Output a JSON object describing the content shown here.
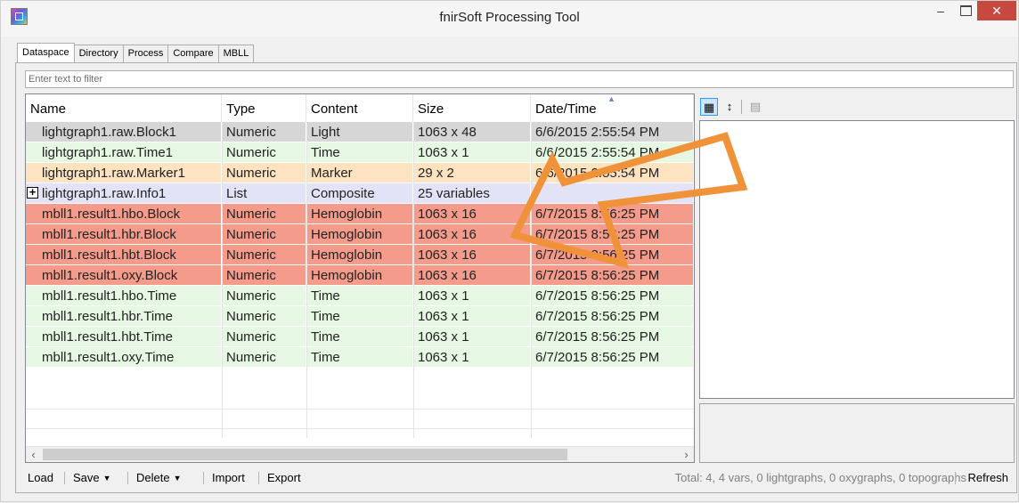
{
  "window": {
    "title": "fnirSoft Processing Tool",
    "minimize": "–",
    "close": "✕"
  },
  "tabs": [
    "Dataspace",
    "Directory",
    "Process",
    "Compare",
    "MBLL"
  ],
  "active_tab": "Dataspace",
  "filter": {
    "placeholder": "Enter text to filter"
  },
  "table": {
    "columns": [
      "Name",
      "Type",
      "Content",
      "Size",
      "Date/Time"
    ],
    "sorted_column": "Date/Time",
    "rows": [
      {
        "name": "lightgraph1.raw.Block1",
        "type": "Numeric",
        "content": "Light",
        "size": "1063 x 48",
        "datetime": "6/6/2015 2:55:54 PM",
        "color": "#d6d6d6",
        "expandable": false
      },
      {
        "name": "lightgraph1.raw.Time1",
        "type": "Numeric",
        "content": "Time",
        "size": "1063 x 1",
        "datetime": "6/6/2015 2:55:54 PM",
        "color": "#e6f7e3",
        "expandable": false
      },
      {
        "name": "lightgraph1.raw.Marker1",
        "type": "Numeric",
        "content": "Marker",
        "size": "29 x 2",
        "datetime": "6/6/2015 2:55:54 PM",
        "color": "#fde3c0",
        "expandable": false
      },
      {
        "name": "lightgraph1.raw.Info1",
        "type": "List",
        "content": "Composite",
        "size": "25 variables",
        "datetime": "",
        "color": "#e3e3f7",
        "expandable": true
      },
      {
        "name": "mbll1.result1.hbo.Block",
        "type": "Numeric",
        "content": "Hemoglobin",
        "size": "1063 x 16",
        "datetime": "6/7/2015 8:56:25 PM",
        "color": "#f59b8b",
        "expandable": false
      },
      {
        "name": "mbll1.result1.hbr.Block",
        "type": "Numeric",
        "content": "Hemoglobin",
        "size": "1063 x 16",
        "datetime": "6/7/2015 8:56:25 PM",
        "color": "#f59b8b",
        "expandable": false
      },
      {
        "name": "mbll1.result1.hbt.Block",
        "type": "Numeric",
        "content": "Hemoglobin",
        "size": "1063 x 16",
        "datetime": "6/7/2015 8:56:25 PM",
        "color": "#f59b8b",
        "expandable": false
      },
      {
        "name": "mbll1.result1.oxy.Block",
        "type": "Numeric",
        "content": "Hemoglobin",
        "size": "1063 x 16",
        "datetime": "6/7/2015 8:56:25 PM",
        "color": "#f59b8b",
        "expandable": false
      },
      {
        "name": "mbll1.result1.hbo.Time",
        "type": "Numeric",
        "content": "Time",
        "size": "1063 x 1",
        "datetime": "6/7/2015 8:56:25 PM",
        "color": "#e6f7e3",
        "expandable": false
      },
      {
        "name": "mbll1.result1.hbr.Time",
        "type": "Numeric",
        "content": "Time",
        "size": "1063 x 1",
        "datetime": "6/7/2015 8:56:25 PM",
        "color": "#e6f7e3",
        "expandable": false
      },
      {
        "name": "mbll1.result1.hbt.Time",
        "type": "Numeric",
        "content": "Time",
        "size": "1063 x 1",
        "datetime": "6/7/2015 8:56:25 PM",
        "color": "#e6f7e3",
        "expandable": false
      },
      {
        "name": "mbll1.result1.oxy.Time",
        "type": "Numeric",
        "content": "Time",
        "size": "1063 x 1",
        "datetime": "6/7/2015 8:56:25 PM",
        "color": "#e6f7e3",
        "expandable": false
      }
    ]
  },
  "property_grid": {
    "categorized_icon": "categorized-icon",
    "alphabetical_icon": "alphabetical-sort-icon",
    "pages_icon": "property-pages-icon"
  },
  "toolbar": {
    "load": "Load",
    "save": "Save",
    "delete": "Delete",
    "import": "Import",
    "export": "Export",
    "totals": "Total: 4, 4 vars, 0 lightgraphs, 0 oxygraphs, 0 topographs",
    "refresh": "Refresh"
  },
  "annotation": {
    "arrow_color": "#f0923a"
  }
}
